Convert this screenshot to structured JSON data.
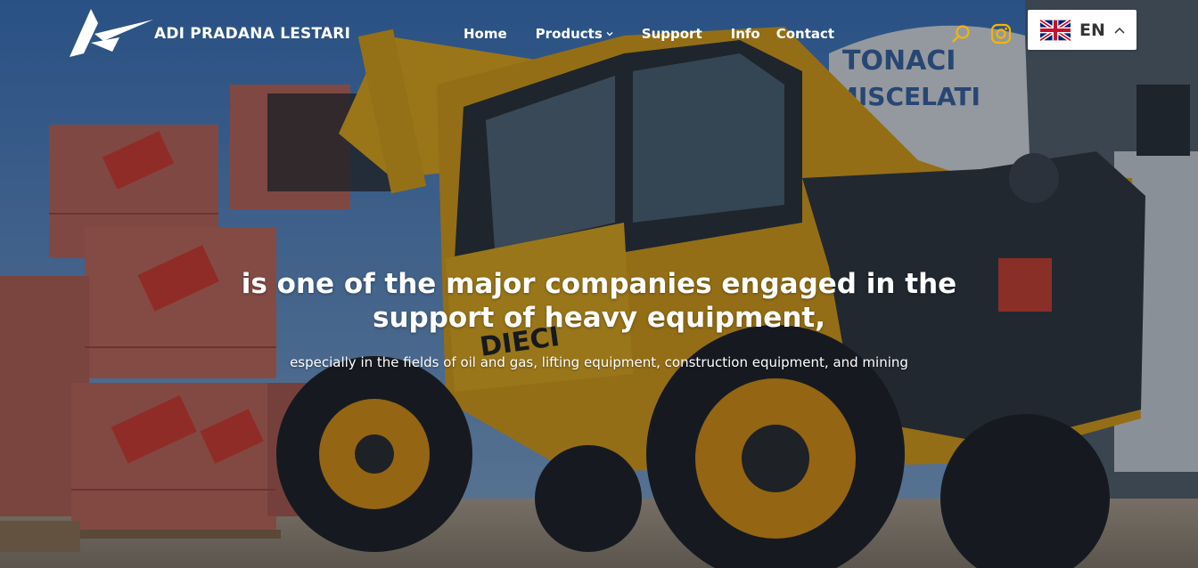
{
  "brand": {
    "name": "ADI PRADANA LESTARI"
  },
  "nav": {
    "items": [
      {
        "label": "Home"
      },
      {
        "label": "Products"
      },
      {
        "label": "Support"
      },
      {
        "label": "Info"
      },
      {
        "label": "Contact"
      }
    ]
  },
  "icons": {
    "search": "search-icon",
    "instagram": "instagram-icon",
    "accent_color": "#f5b400"
  },
  "language": {
    "code": "EN",
    "flag": "uk-flag-icon"
  },
  "hero": {
    "headline": "is one of the major companies engaged in the support of heavy equipment,",
    "subline": "especially in the fields of oil and gas, lifting equipment, construction equipment, and mining"
  }
}
